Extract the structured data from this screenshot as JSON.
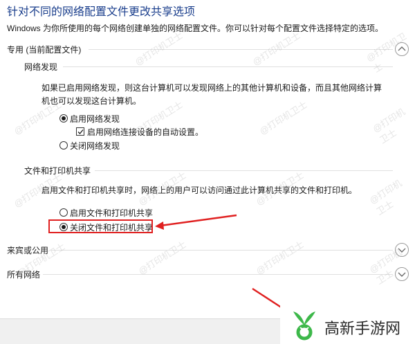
{
  "header": {
    "title": "针对不同的网络配置文件更改共享选项",
    "description": "Windows 为你所使用的每个网络创建单独的网络配置文件。你可以针对每个配置文件选择特定的选项。"
  },
  "private_section": {
    "label": "专用 (当前配置文件)",
    "network_discovery": {
      "heading": "网络发现",
      "text": "如果已启用网络发现，则这台计算机可以发现网络上的其他计算机和设备，而且其他网络计算机也可以发现这台计算机。",
      "option_on": "启用网络发现",
      "auto_setup": "启用网络连接设备的自动设置。",
      "option_off": "关闭网络发现"
    },
    "file_printer_sharing": {
      "heading": "文件和打印机共享",
      "text": "启用文件和打印机共享时，网络上的用户可以访问通过此计算机共享的文件和打印机。",
      "option_on": "启用文件和打印机共享",
      "option_off": "关闭文件和打印机共享"
    }
  },
  "guest_section": {
    "label": "来宾或公用"
  },
  "all_networks_section": {
    "label": "所有网络"
  },
  "watermark": "@打印机卫士",
  "brand": {
    "name": "高新手游网",
    "accent": "#e02020"
  }
}
